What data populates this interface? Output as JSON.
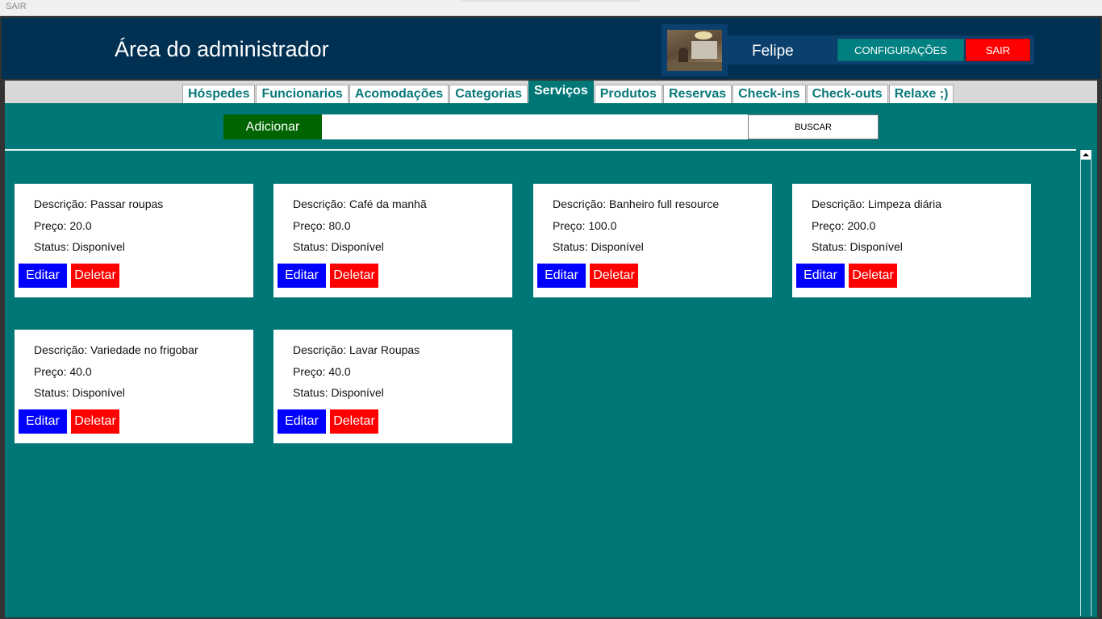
{
  "window": {
    "title": "SAIR"
  },
  "header": {
    "title": "Área do administrador",
    "user_name": "Felipe",
    "config_label": "CONFIGURAÇÕES",
    "logout_label": "SAIR"
  },
  "tabs": [
    {
      "label": "Hóspedes",
      "active": false
    },
    {
      "label": "Funcionarios",
      "active": false
    },
    {
      "label": "Acomodações",
      "active": false
    },
    {
      "label": "Categorias",
      "active": false
    },
    {
      "label": "Serviços",
      "active": true
    },
    {
      "label": "Produtos",
      "active": false
    },
    {
      "label": "Reservas",
      "active": false
    },
    {
      "label": "Check-ins",
      "active": false
    },
    {
      "label": "Check-outs",
      "active": false
    },
    {
      "label": "Relaxe ;)",
      "active": false
    }
  ],
  "toolbar": {
    "add_label": "Adicionar",
    "search_value": "",
    "search_label": "BUSCAR"
  },
  "services": [
    {
      "descricao": "Descrição: Passar roupas",
      "preco": "Preço: 20.0",
      "status": "Status: Disponível",
      "edit_label": "Editar",
      "delete_label": "Deletar"
    },
    {
      "descricao": "Descrição: Café da manhã",
      "preco": "Preço: 80.0",
      "status": "Status: Disponível",
      "edit_label": "Editar",
      "delete_label": "Deletar"
    },
    {
      "descricao": "Descrição: Banheiro full resource",
      "preco": "Preço: 100.0",
      "status": "Status: Disponível",
      "edit_label": "Editar",
      "delete_label": "Deletar"
    },
    {
      "descricao": "Descrição: Limpeza diária",
      "preco": "Preço: 200.0",
      "status": "Status: Disponível",
      "edit_label": "Editar",
      "delete_label": "Deletar"
    },
    {
      "descricao": "Descrição: Variedade no frigobar",
      "preco": "Preço: 40.0",
      "status": "Status: Disponível",
      "edit_label": "Editar",
      "delete_label": "Deletar"
    },
    {
      "descricao": "Descrição: Lavar Roupas",
      "preco": "Preço: 40.0",
      "status": "Status: Disponível",
      "edit_label": "Editar",
      "delete_label": "Deletar"
    }
  ],
  "colors": {
    "header_bg": "#003153",
    "content_bg": "#007777",
    "tab_text": "#0b7979",
    "add_button": "#006400",
    "edit_button": "#0000ff",
    "delete_button": "#ff0000",
    "config_button": "#008080"
  },
  "icons": {
    "scroll_up": "triangle-up-icon"
  }
}
